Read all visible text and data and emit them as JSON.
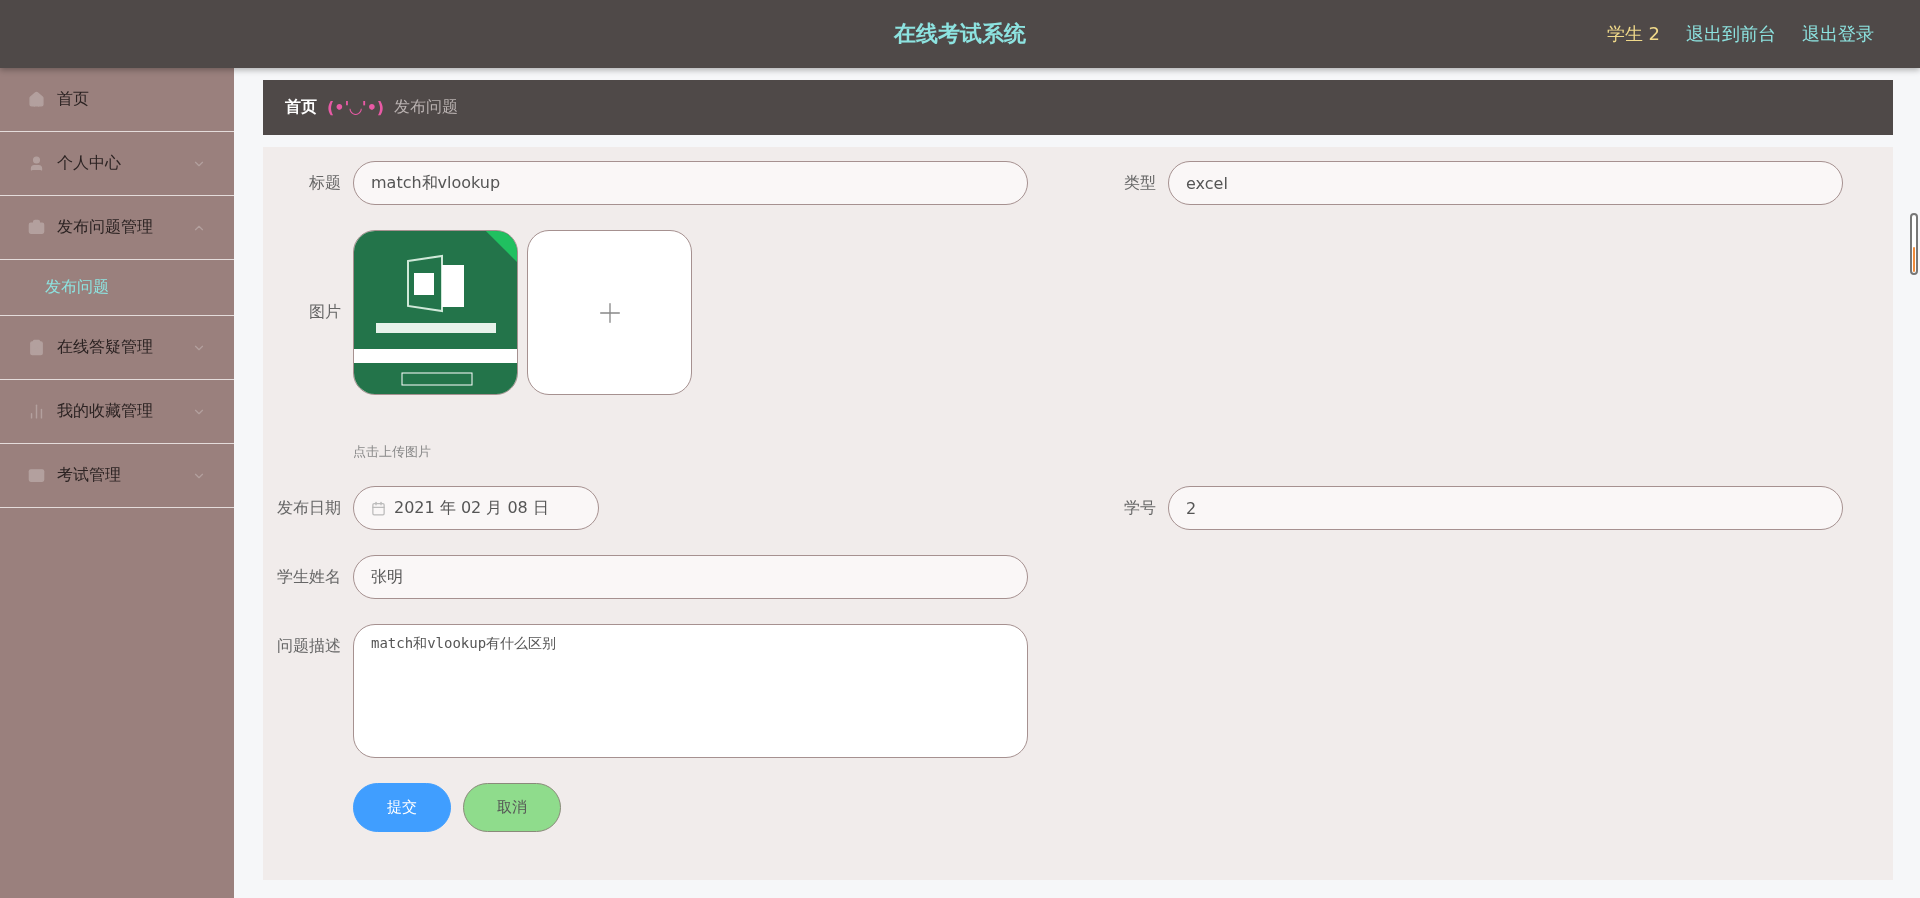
{
  "header": {
    "title": "在线考试系统",
    "user": "学生 2",
    "links": [
      "退出到前台",
      "退出登录"
    ]
  },
  "sidebar": {
    "items": [
      {
        "kind": "link",
        "label": "首页"
      },
      {
        "kind": "group",
        "label": "个人中心",
        "expanded": false
      },
      {
        "kind": "group",
        "label": "发布问题管理",
        "expanded": true,
        "children": [
          {
            "label": "发布问题",
            "selected": true
          }
        ]
      },
      {
        "kind": "group",
        "label": "在线答疑管理",
        "expanded": false
      },
      {
        "kind": "group",
        "label": "我的收藏管理",
        "expanded": false
      },
      {
        "kind": "group",
        "label": "考试管理",
        "expanded": false
      }
    ]
  },
  "breadcrumb": {
    "home": "首页",
    "separator": "(•'◡'•)",
    "current": "发布问题"
  },
  "form": {
    "rows": [
      [
        {
          "kind": "text",
          "label": "标题",
          "value": "match和vlookup"
        },
        {
          "kind": "text",
          "label": "类型",
          "value": "excel"
        }
      ],
      [
        {
          "label": "图片",
          "uploaded": true,
          "hint": "点击上传图片"
        }
      ],
      [
        {
          "kind": "date",
          "label": "发布日期",
          "value": "2021 年 02 月 08 日"
        },
        {
          "kind": "text",
          "label": "学号",
          "value": "2"
        }
      ],
      [
        {
          "kind": "text",
          "label": "学生姓名",
          "value": "张明"
        }
      ],
      [
        {
          "kind": "textarea",
          "label": "问题描述",
          "value": "match和vlookup有什么区别"
        }
      ]
    ],
    "buttons": [
      {
        "kind": "primary",
        "label": "提交"
      },
      {
        "kind": "secondary",
        "label": "取消"
      }
    ]
  }
}
